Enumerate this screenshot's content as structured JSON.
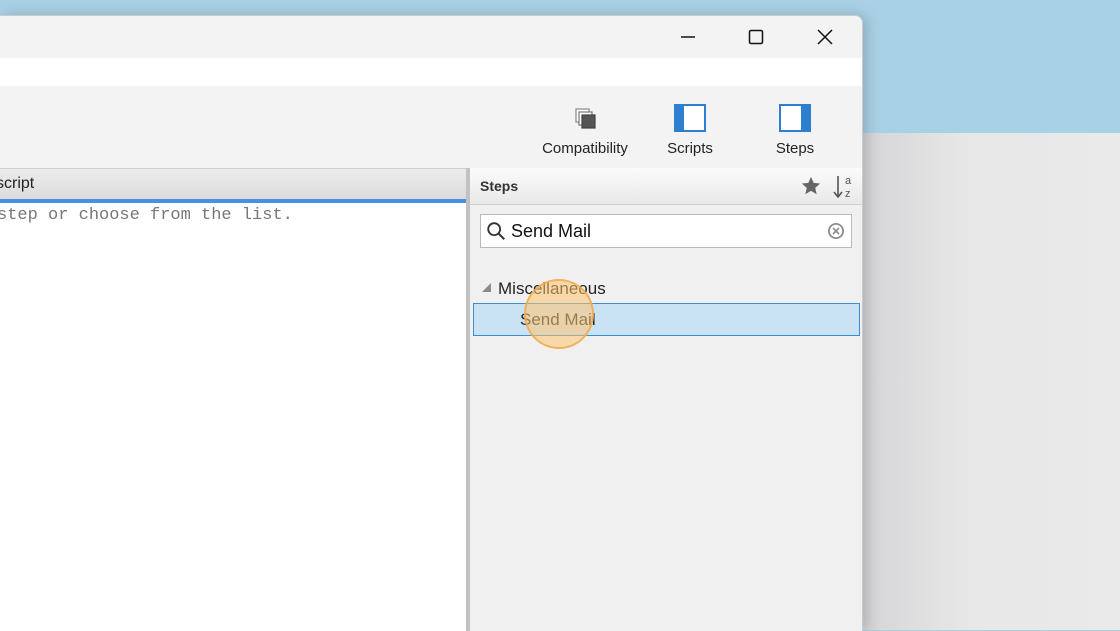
{
  "toolbar": {
    "compatibility_label": "Compatibility",
    "scripts_label": "Scripts",
    "steps_label": "Steps"
  },
  "editor": {
    "tab_label": "script",
    "hint": "step or choose from the list."
  },
  "steps_panel": {
    "title": "Steps",
    "search_value": "Send Mail",
    "group_label": "Miscellaneous",
    "items": [
      {
        "label": "Send Mail",
        "selected": true
      }
    ]
  },
  "colors": {
    "accent": "#4a90e2",
    "selection": "#c9e3f5",
    "desktop": "#a9d1e6"
  }
}
